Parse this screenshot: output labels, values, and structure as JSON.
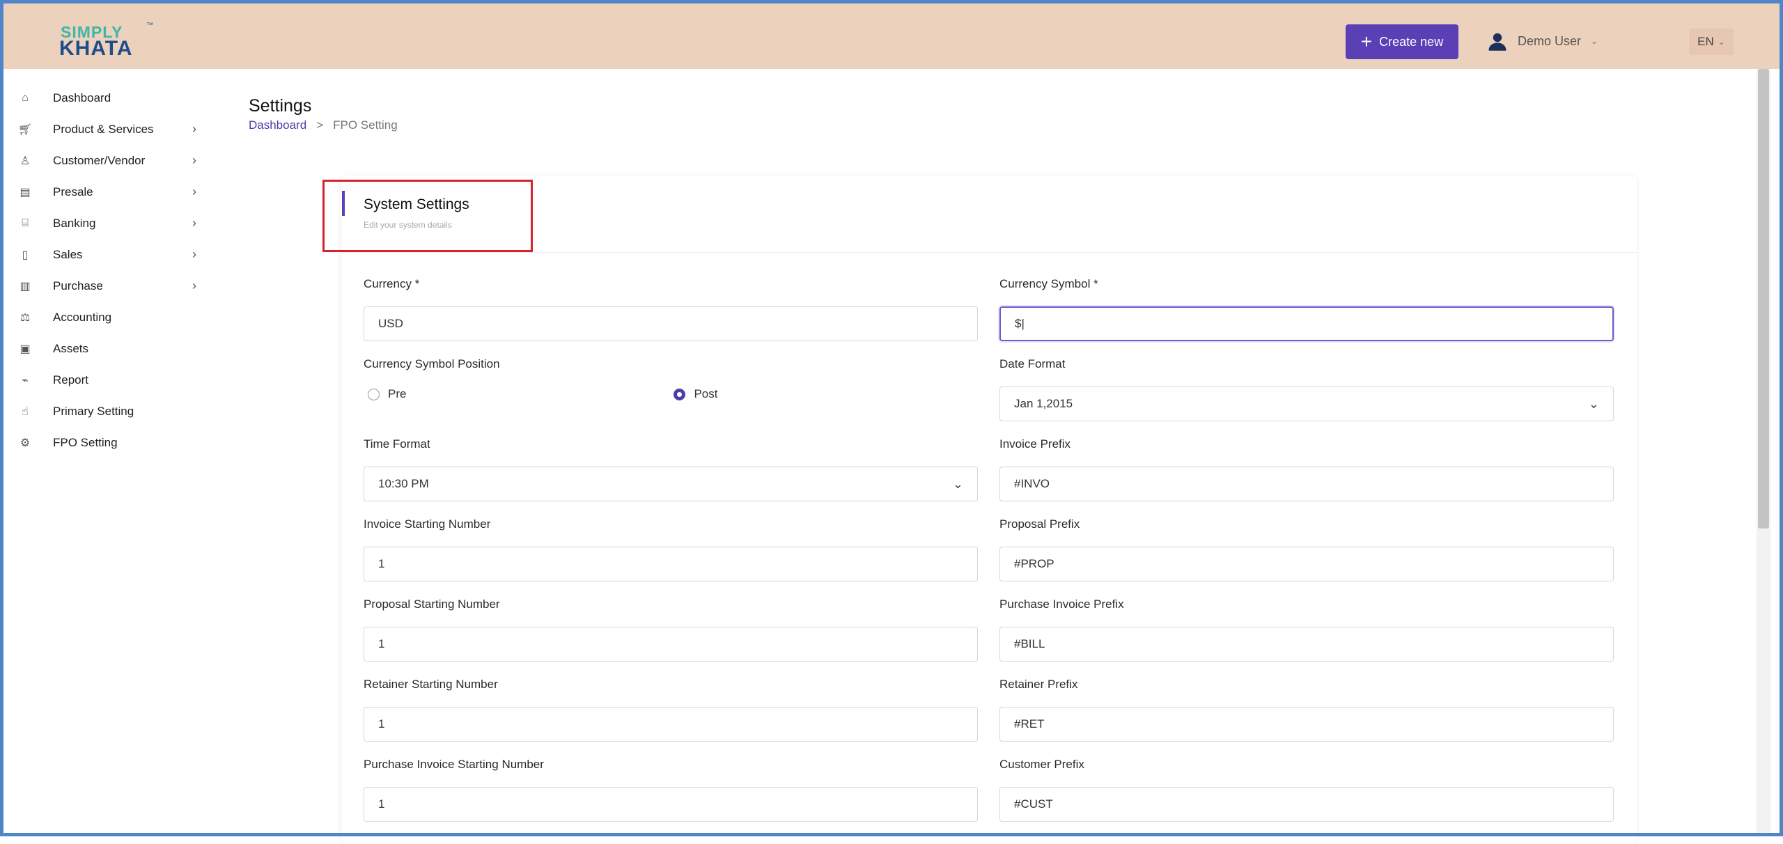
{
  "header": {
    "logo_top": "SIMPLY",
    "logo_bottom": "KHATA",
    "create_new_label": "Create new",
    "user_name": "Demo User",
    "language": "EN"
  },
  "sidebar": {
    "items": [
      {
        "label": "Dashboard",
        "icon": "home-icon"
      },
      {
        "label": "Product & Services",
        "icon": "cart-icon",
        "has_children": true
      },
      {
        "label": "Customer/Vendor",
        "icon": "user-plus-icon",
        "has_children": true
      },
      {
        "label": "Presale",
        "icon": "building-icon",
        "has_children": true
      },
      {
        "label": "Banking",
        "icon": "bank-icon",
        "has_children": true
      },
      {
        "label": "Sales",
        "icon": "document-icon",
        "has_children": true
      },
      {
        "label": "Purchase",
        "icon": "receipt-icon",
        "has_children": true
      },
      {
        "label": "Accounting",
        "icon": "scale-icon"
      },
      {
        "label": "Assets",
        "icon": "clipboard-icon"
      },
      {
        "label": "Report",
        "icon": "chart-icon"
      },
      {
        "label": "Primary Setting",
        "icon": "hand-icon"
      },
      {
        "label": "FPO Setting",
        "icon": "gear-icon"
      }
    ]
  },
  "page": {
    "title": "Settings",
    "breadcrumb_home": "Dashboard",
    "breadcrumb_sep": ">",
    "breadcrumb_current": "FPO Setting"
  },
  "card": {
    "title": "System Settings",
    "subtitle": "Edit your system details"
  },
  "form": {
    "currency": {
      "label": "Currency *",
      "value": "USD"
    },
    "currency_symbol": {
      "label": "Currency Symbol *",
      "value": "$|"
    },
    "symbol_position": {
      "label": "Currency Symbol Position",
      "options": [
        "Pre",
        "Post"
      ],
      "selected": "Post"
    },
    "date_format": {
      "label": "Date Format",
      "value": "Jan 1,2015"
    },
    "time_format": {
      "label": "Time Format",
      "value": "10:30 PM"
    },
    "invoice_prefix": {
      "label": "Invoice Prefix",
      "value": "#INVO"
    },
    "invoice_start": {
      "label": "Invoice Starting Number",
      "value": "1"
    },
    "proposal_prefix": {
      "label": "Proposal Prefix",
      "value": "#PROP"
    },
    "proposal_start": {
      "label": "Proposal Starting Number",
      "value": "1"
    },
    "purchase_invoice_prefix": {
      "label": "Purchase Invoice Prefix",
      "value": "#BILL"
    },
    "retainer_start": {
      "label": "Retainer Starting Number",
      "value": "1"
    },
    "retainer_prefix": {
      "label": "Retainer Prefix",
      "value": "#RET"
    },
    "purchase_invoice_start": {
      "label": "Purchase Invoice Starting Number",
      "value": "1"
    },
    "customer_prefix": {
      "label": "Customer Prefix",
      "value": "#CUST"
    }
  },
  "colors": {
    "topbar": "#ecd1bd",
    "accent": "#5a3fb5",
    "highlight": "#d9232b"
  }
}
